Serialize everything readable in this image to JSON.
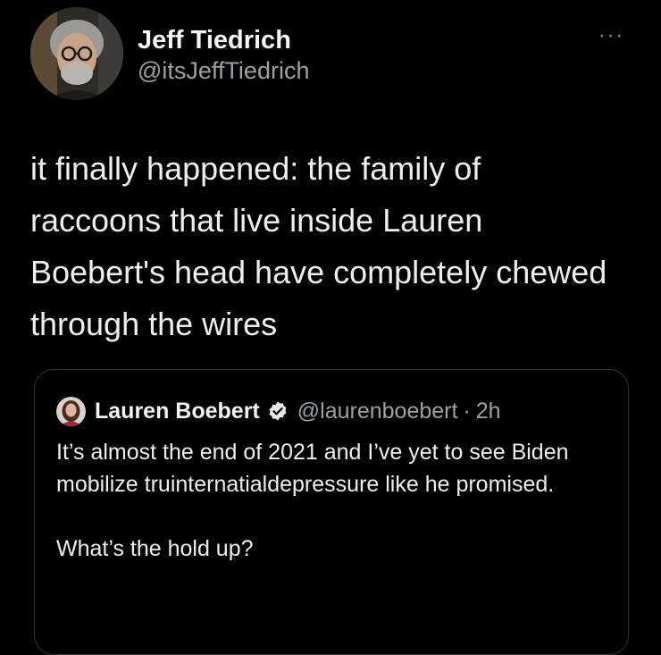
{
  "tweet": {
    "author": {
      "display_name": "Jeff Tiedrich",
      "handle": "@itsJeffTiedrich",
      "avatar_icon": "profile-photo"
    },
    "more_icon": "ellipsis-icon",
    "more_label": "···",
    "text": "it finally happened: the family of raccoons that live inside Lauren Boebert's head have completely chewed through the wires"
  },
  "quoted_tweet": {
    "author": {
      "display_name": "Lauren Boebert",
      "handle": "@laurenboebert",
      "verified_icon": "verified-badge-icon",
      "avatar_icon": "profile-photo"
    },
    "separator": "·",
    "time": "2h",
    "text_line1": "It’s almost the end of 2021 and I’ve yet to see Biden mobilize truinternatialdepressure like he promised.",
    "text_line2": "What’s the hold up?"
  },
  "colors": {
    "background": "#000000",
    "text": "#e7e9ea",
    "secondary_text": "#9aa0a6",
    "border": "#2f3336"
  }
}
